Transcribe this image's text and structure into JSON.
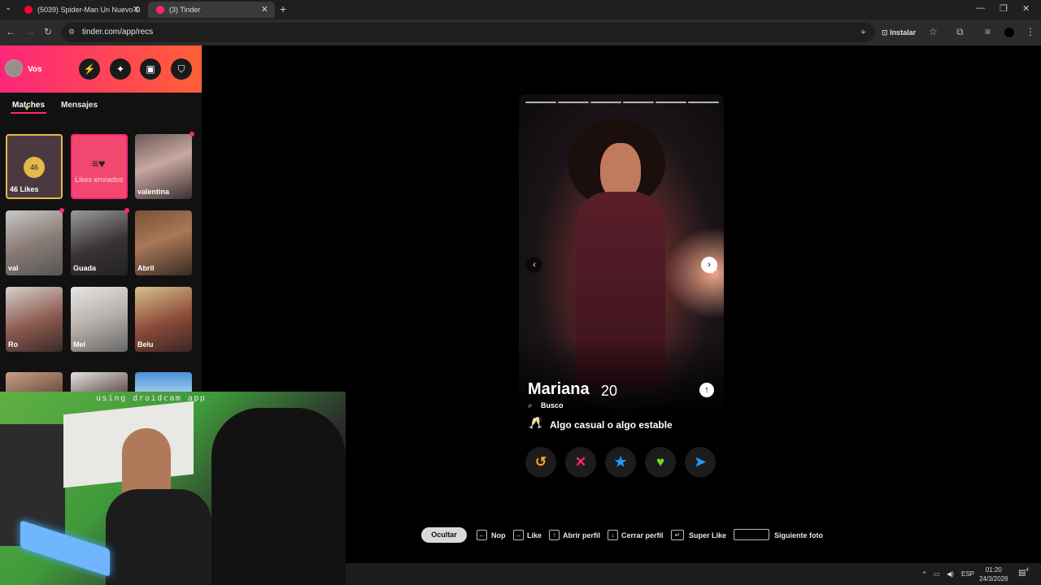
{
  "browser": {
    "tabs": [
      {
        "title": "(5039) Spider-Man Un Nuevo D",
        "favicon_color": "#ff0033"
      },
      {
        "title": "(3) Tinder",
        "favicon_color": "#fd267a"
      }
    ],
    "url": "tinder.com/app/recs",
    "install_label": "Instalar"
  },
  "sidebar": {
    "user_name": "Vos",
    "tabs": {
      "matches": "Matches",
      "messages": "Mensajes"
    },
    "likes_count": "46",
    "likes_label": "46 Likes",
    "sent_label": "Likes enviados",
    "matches": [
      {
        "name": "valentina",
        "unread": true
      },
      {
        "name": "val",
        "unread": true
      },
      {
        "name": "Guada",
        "unread": true
      },
      {
        "name": "Abril",
        "unread": false
      },
      {
        "name": "Ro",
        "unread": false
      },
      {
        "name": "Mel",
        "unread": false
      },
      {
        "name": "Belu",
        "unread": false
      }
    ]
  },
  "webcam": {
    "overlay_text": "using droidcam app"
  },
  "profile": {
    "name": "Mariana",
    "age": "20",
    "looking_label": "Busco",
    "intent": "Algo casual o algo estable",
    "photo_count": 6
  },
  "actions": [
    {
      "icon": "rewind-icon",
      "glyph": "↺",
      "color": "#f5a623"
    },
    {
      "icon": "nope-icon",
      "glyph": "✕",
      "color": "#fd267a"
    },
    {
      "icon": "super-like-icon",
      "glyph": "★",
      "color": "#1e9bff"
    },
    {
      "icon": "like-icon",
      "glyph": "♥",
      "color": "#6be01a"
    },
    {
      "icon": "boost-icon",
      "glyph": "➤",
      "color": "#1e9bff"
    }
  ],
  "shortcuts": {
    "hide": "Ocultar",
    "nope": "Nop",
    "like": "Like",
    "open_profile": "Abrir perfil",
    "close_profile": "Cerrar perfil",
    "super_like": "Super Like",
    "next_photo": "Siguiente foto"
  },
  "taskbar": {
    "language": "ESP",
    "time": "01:20",
    "date": "24/3/2026",
    "notifications": "4"
  }
}
